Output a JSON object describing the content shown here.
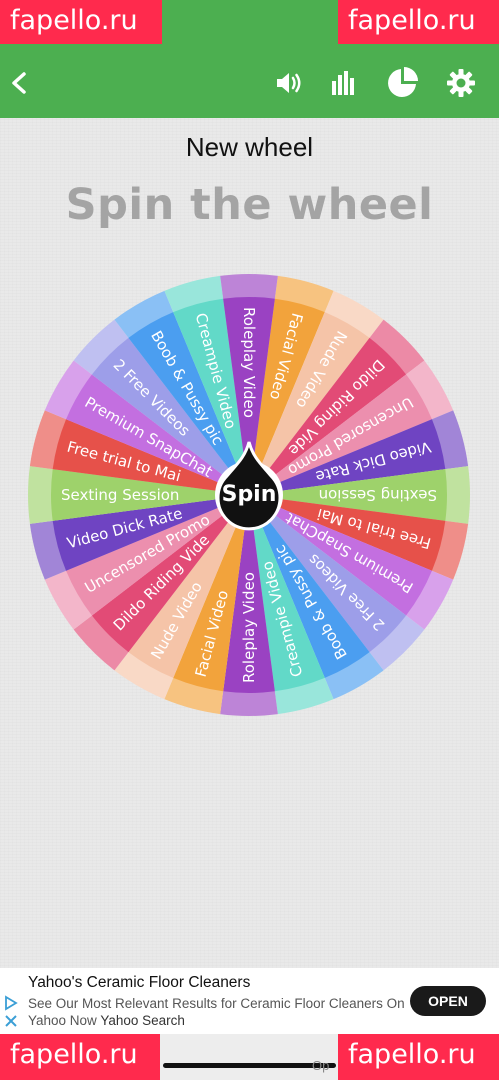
{
  "watermark": {
    "text": "fapello.ru"
  },
  "toolbar": {
    "back_icon": "arrow-left-icon",
    "sound_icon": "volume-icon",
    "stats_icon": "bar-chart-icon",
    "pie_icon": "pie-chart-icon",
    "settings_icon": "gear-icon"
  },
  "page": {
    "title": "New wheel",
    "subtitle": "Spin the wheel"
  },
  "wheel": {
    "spin_label": "Spin",
    "segments": [
      {
        "label": "Facial Video",
        "color": "#f2a33c"
      },
      {
        "label": "Nude Video",
        "color": "#f5c4a8"
      },
      {
        "label": "Dildo Riding Video",
        "color": "#e24b76"
      },
      {
        "label": "Uncensored Promo",
        "color": "#ec8fae"
      },
      {
        "label": "Video Dick Rate",
        "color": "#6f44c2"
      },
      {
        "label": "Sexting Session",
        "color": "#9ed26b"
      },
      {
        "label": "Free trial to Main Page",
        "color": "#e6514a"
      },
      {
        "label": "Premium SnapChat",
        "color": "#c36fe0"
      },
      {
        "label": "2 Free Videos",
        "color": "#9d9ee9"
      },
      {
        "label": "Boob & Pussy pic",
        "color": "#4b9ef0"
      },
      {
        "label": "Creampie Video",
        "color": "#62d9c8"
      },
      {
        "label": "Roleplay Video",
        "color": "#9a42c2"
      }
    ]
  },
  "ad": {
    "title": "Yahoo's Ceramic Floor Cleaners",
    "body": "See Our Most Relevant Results for Ceramic Floor Cleaners On Yahoo Now",
    "source": "Yahoo Search",
    "cta": "OPEN"
  },
  "footer": {
    "partial_text": "Op"
  }
}
